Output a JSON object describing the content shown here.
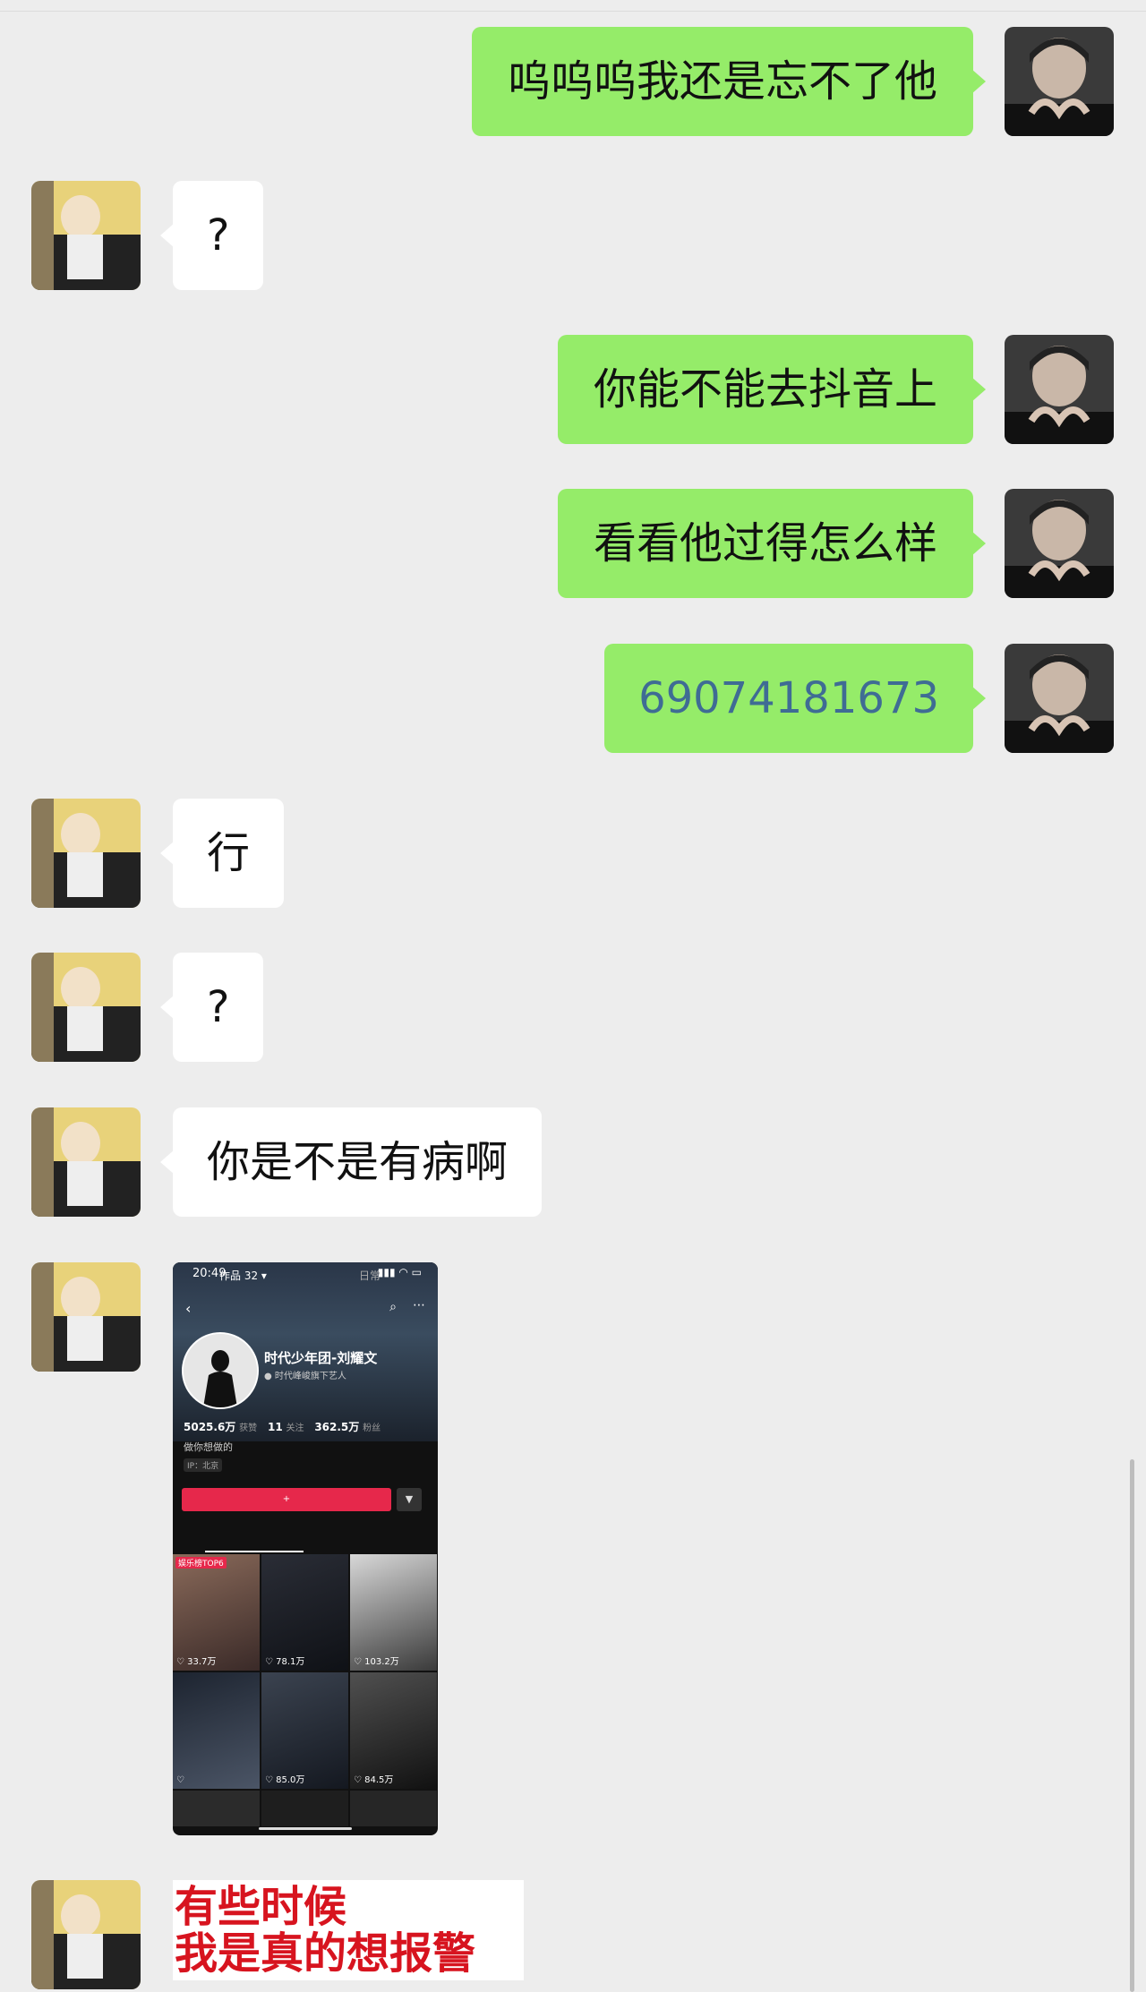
{
  "messages": [
    {
      "from": "me",
      "text": "呜呜呜我还是忘不了他"
    },
    {
      "from": "them",
      "text": "?"
    },
    {
      "from": "me",
      "text": "你能不能去抖音上"
    },
    {
      "from": "me",
      "text": "看看他过得怎么样"
    },
    {
      "from": "me",
      "text": "69074181673"
    },
    {
      "from": "them",
      "text": "行"
    },
    {
      "from": "them",
      "text": "?"
    },
    {
      "from": "them",
      "text": "你是不是有病啊"
    },
    {
      "from": "them",
      "type": "image"
    },
    {
      "from": "them",
      "type": "sticker"
    }
  ],
  "screenshot": {
    "status_time": "20:49",
    "profile_name": "时代少年团-刘耀文",
    "verification": "时代峰峻旗下艺人",
    "likes_value": "5025.6万",
    "likes_label": "获赞",
    "following_value": "11",
    "following_label": "关注",
    "followers_value": "362.5万",
    "followers_label": "粉丝",
    "bio": "做你想做的",
    "ip": "IP：北京",
    "tab_works": "作品 32 ▾",
    "tab_daily": "日常",
    "pinned_tag": "娱乐榜TOP6",
    "video_likes": [
      "33.7万",
      "78.1万",
      "103.2万",
      "",
      "85.0万",
      "84.5万"
    ]
  },
  "sticker": {
    "line1": "有些时候",
    "line2": "我是真的想报警"
  },
  "colors": {
    "background": "#EDEDED",
    "my_bubble": "#95EC69",
    "their_bubble": "#FFFFFF",
    "link_text": "#3F6C94",
    "sticker_text": "#D7141F"
  }
}
